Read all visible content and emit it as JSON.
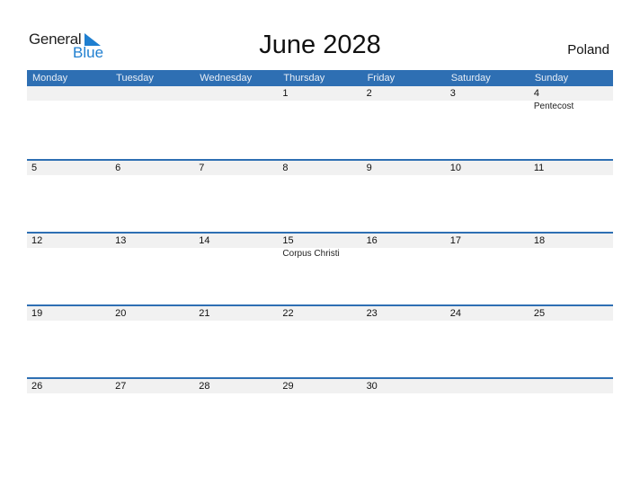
{
  "logo": {
    "line1": "General",
    "line2": "Blue"
  },
  "title": "June 2028",
  "country": "Poland",
  "weekdays": [
    "Monday",
    "Tuesday",
    "Wednesday",
    "Thursday",
    "Friday",
    "Saturday",
    "Sunday"
  ],
  "weeks": [
    {
      "days": [
        "",
        "",
        "",
        "1",
        "2",
        "3",
        "4"
      ],
      "events": [
        "",
        "",
        "",
        "",
        "",
        "",
        "Pentecost"
      ]
    },
    {
      "days": [
        "5",
        "6",
        "7",
        "8",
        "9",
        "10",
        "11"
      ],
      "events": [
        "",
        "",
        "",
        "",
        "",
        "",
        ""
      ]
    },
    {
      "days": [
        "12",
        "13",
        "14",
        "15",
        "16",
        "17",
        "18"
      ],
      "events": [
        "",
        "",
        "",
        "Corpus Christi",
        "",
        "",
        ""
      ]
    },
    {
      "days": [
        "19",
        "20",
        "21",
        "22",
        "23",
        "24",
        "25"
      ],
      "events": [
        "",
        "",
        "",
        "",
        "",
        "",
        ""
      ]
    },
    {
      "days": [
        "26",
        "27",
        "28",
        "29",
        "30",
        "",
        ""
      ],
      "events": [
        "",
        "",
        "",
        "",
        "",
        "",
        ""
      ]
    }
  ],
  "colors": {
    "accent": "#2e6fb3",
    "logo_blue": "#1f7fd0",
    "date_row_bg": "#f1f1f1"
  }
}
